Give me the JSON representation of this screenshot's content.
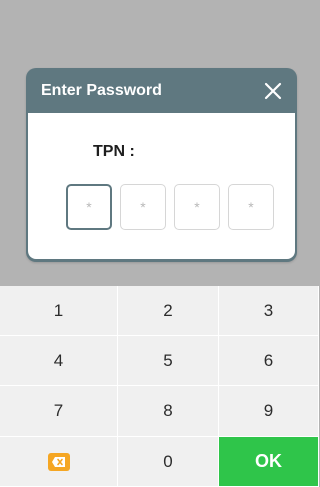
{
  "dialog": {
    "title": "Enter Password",
    "close_icon": "close-icon",
    "field_label": "TPN :",
    "pin_placeholders": [
      "*",
      "*",
      "*",
      "*"
    ]
  },
  "keypad": {
    "keys": [
      "1",
      "2",
      "3",
      "4",
      "5",
      "6",
      "7",
      "8",
      "9",
      "",
      "0",
      "OK"
    ],
    "delete_icon": "backspace-icon",
    "ok_color": "#2fc54a",
    "delete_color": "#f5a623"
  },
  "colors": {
    "header": "#5f7880",
    "backdrop": "#b3b3b3",
    "key_bg": "#f0f0f0"
  }
}
